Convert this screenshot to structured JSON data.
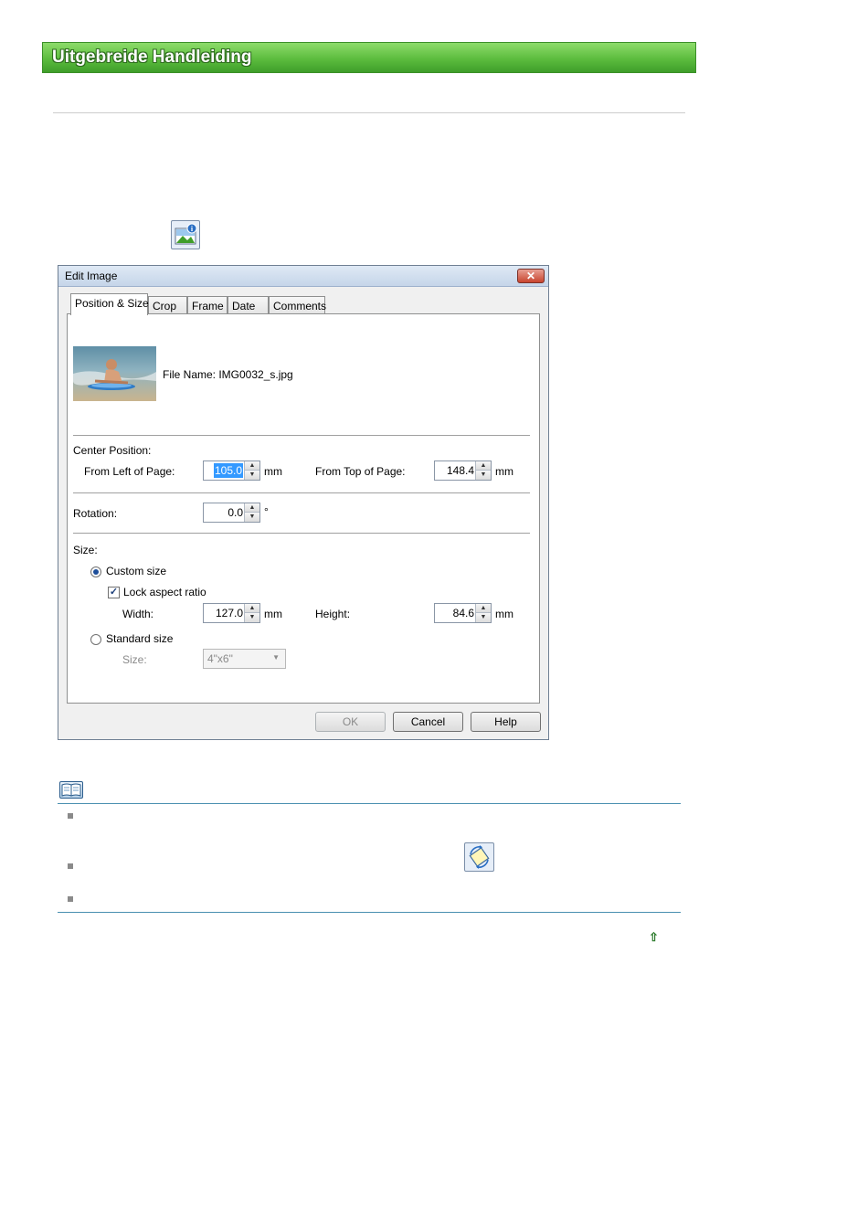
{
  "banner": {
    "title": "Uitgebreide Handleiding"
  },
  "dialog": {
    "title": "Edit Image",
    "close_label": "✕",
    "tabs": [
      {
        "label": "Position & Size",
        "active": true
      },
      {
        "label": "Crop"
      },
      {
        "label": "Frame"
      },
      {
        "label": "Date"
      },
      {
        "label": "Comments"
      }
    ],
    "file_name_label": "File Name: IMG0032_s.jpg",
    "center_position": {
      "heading": "Center Position:",
      "from_left_label": "From Left of Page:",
      "from_left_value": "105.0",
      "from_left_unit": "mm",
      "from_top_label": "From Top of Page:",
      "from_top_value": "148.4",
      "from_top_unit": "mm"
    },
    "rotation": {
      "label": "Rotation:",
      "value": "0.0",
      "unit": "°"
    },
    "size": {
      "heading": "Size:",
      "custom_size_label": "Custom size",
      "custom_size_selected": true,
      "lock_aspect_label": "Lock aspect ratio",
      "lock_aspect_checked": true,
      "width_label": "Width:",
      "width_value": "127.0",
      "width_unit": "mm",
      "height_label": "Height:",
      "height_value": "84.6",
      "height_unit": "mm",
      "standard_size_label": "Standard size",
      "standard_size_selected": false,
      "size_label": "Size:",
      "size_value": "4\"x6\""
    },
    "buttons": {
      "ok": "OK",
      "cancel": "Cancel",
      "help": "Help"
    }
  },
  "colors": {
    "banner_green": "#5cbc3e",
    "note_line": "#4a8fb0",
    "selection": "#3399ff"
  },
  "icons": {
    "top_icon": "image-info-icon",
    "note_icon": "note-book-icon",
    "mid_icon": "rotate-image-icon",
    "back_to_top": "up-arrow-icon"
  },
  "back_to_top_glyph": "⇧"
}
